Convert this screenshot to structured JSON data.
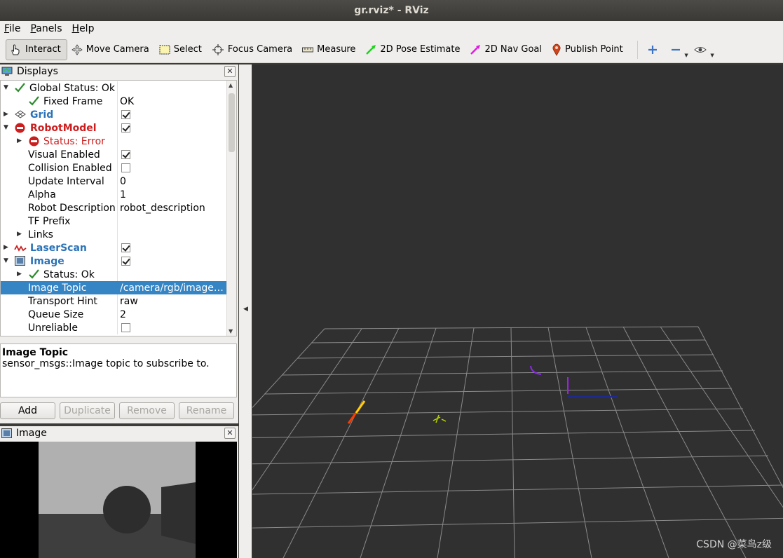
{
  "window": {
    "title": "gr.rviz* - RViz"
  },
  "menu": [
    {
      "label": "File",
      "accel": "F",
      "rest": "ile"
    },
    {
      "label": "Panels",
      "accel": "P",
      "rest": "anels"
    },
    {
      "label": "Help",
      "accel": "H",
      "rest": "elp"
    }
  ],
  "toolbar": {
    "interact": "Interact",
    "move_camera": "Move Camera",
    "select": "Select",
    "focus_camera": "Focus Camera",
    "measure": "Measure",
    "pose_estimate": "2D Pose Estimate",
    "nav_goal": "2D Nav Goal",
    "publish_point": "Publish Point",
    "active_tool": "Interact"
  },
  "displays_panel": {
    "title": "Displays",
    "close": "✕",
    "rows": {
      "global_status": {
        "label": "Global Status: Ok"
      },
      "fixed_frame": {
        "label": "Fixed Frame",
        "value": "OK"
      },
      "grid": {
        "label": "Grid",
        "checked": true
      },
      "robot_model": {
        "label": "RobotModel",
        "checked": true
      },
      "status_error": {
        "label": "Status: Error"
      },
      "visual_enabled": {
        "label": "Visual Enabled",
        "checked": true
      },
      "collision_enabled": {
        "label": "Collision Enabled",
        "checked": false
      },
      "update_interval": {
        "label": "Update Interval",
        "value": "0"
      },
      "alpha": {
        "label": "Alpha",
        "value": "1"
      },
      "robot_description": {
        "label": "Robot Description",
        "value": "robot_description"
      },
      "tf_prefix": {
        "label": "TF Prefix",
        "value": ""
      },
      "links": {
        "label": "Links"
      },
      "laser_scan": {
        "label": "LaserScan",
        "checked": true
      },
      "image": {
        "label": "Image",
        "checked": true
      },
      "status_ok": {
        "label": "Status: Ok"
      },
      "image_topic": {
        "label": "Image Topic",
        "value": "/camera/rgb/image…"
      },
      "transport_hint": {
        "label": "Transport Hint",
        "value": "raw"
      },
      "queue_size": {
        "label": "Queue Size",
        "value": "2"
      },
      "unreliable": {
        "label": "Unreliable",
        "checked": false
      }
    }
  },
  "description": {
    "title": "Image Topic",
    "text": "sensor_msgs::Image topic to subscribe to."
  },
  "buttons": {
    "add": "Add",
    "duplicate": "Duplicate",
    "remove": "Remove",
    "rename": "Rename"
  },
  "image_panel": {
    "title": "Image",
    "close": "✕"
  },
  "watermark": "CSDN @菜鸟z级",
  "colors": {
    "selection": "#3584c4",
    "display_name_blue": "#2b73b8",
    "error_red": "#cc1e1e",
    "ok_green": "#2e8b2e",
    "viewport_bg": "#303030",
    "grid_line": "#8a8a8a"
  }
}
